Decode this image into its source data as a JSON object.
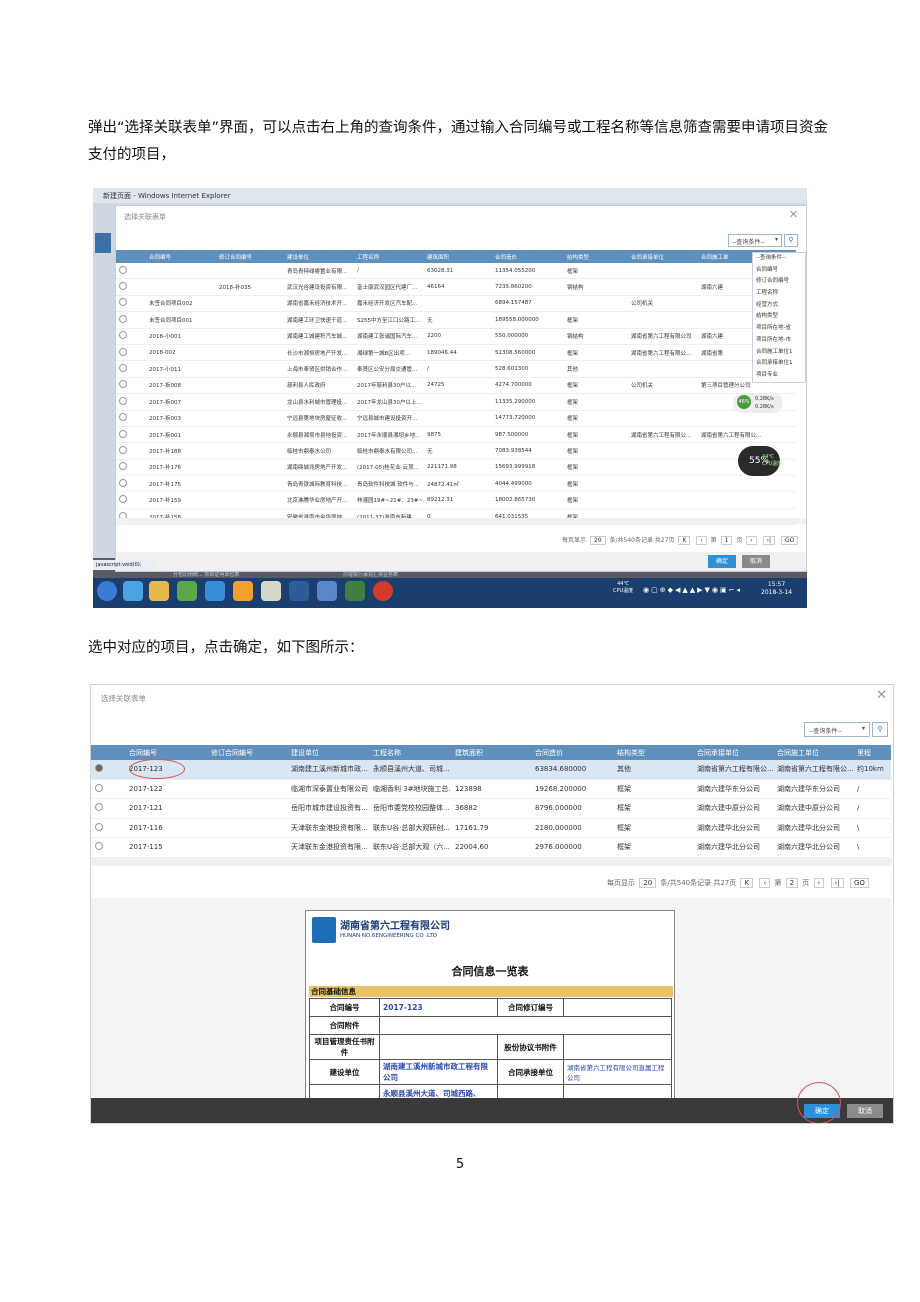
{
  "paragraph1": "弹出“选择关联表单”界面，可以点击右上角的查询条件，通过输入合同编号或工程名称等信息筛查需要申请项目资金支付的项目，",
  "paragraph2": "选中对应的项目，点击确定，如下图所示：",
  "page_number": "5",
  "shot1": {
    "window_title": "新建页面 - Windows Internet Explorer",
    "dialog_title": "选择关联表单",
    "query_select": "--查询条件--",
    "columns": [
      "",
      "合同编号",
      "修订合同编号",
      "建设单位",
      "工程名称",
      "建筑面积",
      "合同造价",
      "结构类型",
      "合同承接单位",
      "合同施工单"
    ],
    "rows": [
      [
        "",
        "",
        "青岛青特绿睿置业有限...",
        "/",
        "63028.31",
        "11354.055200",
        "框架",
        "",
        ""
      ],
      [
        "",
        "2018-补035",
        "武汉光谷建设投资有限...",
        "富士康武汉园区代建厂...",
        "46164",
        "7235.860200",
        "钢结构",
        "",
        "湖南六建"
      ],
      [
        "未签合同项目002",
        "",
        "湖南省嘉禾经济技术开...",
        "嘉禾经济开发区汽车配...",
        "",
        "6894.157487",
        "",
        "公司机关",
        ""
      ],
      [
        "未签合同项目001",
        "",
        "湖南建工环卫快速干道...",
        "S255中方至江口公路工...",
        "无",
        "189558.000000",
        "框架",
        "",
        ""
      ],
      [
        "2018-小001",
        "",
        "湖南建工城建积汽车城...",
        "湖南建工张浦国际汽车...",
        "2200",
        "550.000000",
        "钢结构",
        "湖南省第六工程有限公司",
        "湖南六建"
      ],
      [
        "2018-002",
        "",
        "长沙市湘恒房地产开发...",
        "湘绿第一城B区出项...",
        "189046.44",
        "51308.560000",
        "框架",
        "湖南省第六工程有限公...",
        "湖南省第"
      ],
      [
        "2017-小011",
        "",
        "上海市奉贤区供销合作...",
        "奉贤区公安分局交通管...",
        "/",
        "528.601300",
        "其他",
        "",
        ""
      ],
      [
        "2017-拆008",
        "",
        "慈利县人民政府",
        "2017年慈利县30户以...",
        "24725",
        "4274.700000",
        "框架",
        "公司机关",
        "第三项目管理分公司"
      ],
      [
        "2017-拆007",
        "",
        "龙山县水利城市管理投...",
        "2017年龙山县30户以上...",
        "",
        "11335.290000",
        "框架",
        "",
        ""
      ],
      [
        "2017-拆003",
        "",
        "宁远县第地块房屋征收...",
        "宁远县城市建设投资开...",
        "",
        "14773.720000",
        "框架",
        "",
        ""
      ],
      [
        "2017-拆001",
        "",
        "永顺县湘坝市县地投资...",
        "2017年永顺县湘坝乡地...",
        "9875",
        "987.500000",
        "框架",
        "湖南省第六工程有限公...",
        "湖南省第六工程有限公..."
      ],
      [
        "2017-补188",
        "",
        "临桂市鼎泰水公司",
        "临桂市鼎泰水有限公司...",
        "无",
        "7083.938544",
        "框架",
        "",
        ""
      ],
      [
        "2017-补176",
        "",
        "湖南鼎城兆房地产开发...",
        "(2017-05)桂花业·云顶...",
        "221171.98",
        "15693.999918",
        "框架",
        "",
        ""
      ],
      [
        "2017-补175",
        "",
        "青岛青铁城际教育科技...",
        "青岛软件科技城 软件与...",
        "24872.41㎡",
        "4044.499000",
        "框架",
        "",
        ""
      ],
      [
        "2017-补159",
        "",
        "北京沸腾华业房地产开...",
        "林灌园19#~21#、23#~...",
        "89212.31",
        "18002.865730",
        "框架",
        "",
        ""
      ],
      [
        "2017-补158",
        "",
        "安徽省淮南市金华房地...",
        "(2011-37)淮南市新建...",
        "0",
        "641.031535",
        "框架",
        "",
        ""
      ]
    ],
    "dropdown_options": [
      "--查询条件--",
      "合同编号",
      "修订合同编号",
      "工程名称",
      "经营方式",
      "结构类型",
      "项目所在地-省",
      "项目所在地-市",
      "合同施工单位1",
      "合同承接单位1",
      "项目专业"
    ],
    "pager": {
      "label_each": "每页显示",
      "page_size": "20",
      "total": "条/共540条记录 共27页",
      "page": "1",
      "label_page": "第",
      "label_of": "页",
      "go": "GO"
    },
    "confirm": "确定",
    "cancel": "取消",
    "status_bar": "javascript:void(0);",
    "gauge_percent": "55%",
    "gauge_temp": "44℃",
    "gauge_label": "CPU温度",
    "net_up": "0.28K/s",
    "net_down": "0.28K/s",
    "gauge_small": "46%",
    "clock_time": "15:57",
    "clock_date": "2018-3-14",
    "tray_temp": "44℃",
    "tray_label": "CPU温度",
    "behind_tab1": "分包比例统... 项目证明单位表",
    "behind_tab2": "办理银行承兑汇票业务表"
  },
  "shot2": {
    "dialog_title": "选择关联表单",
    "query_select": "--查询条件--",
    "columns": [
      "",
      "合同编号",
      "修订合同编号",
      "建设单位",
      "工程名称",
      "建筑面积",
      "合同造价",
      "结构类型",
      "合同承接单位",
      "合同施工单位",
      "里程"
    ],
    "rows": [
      [
        "2017-123",
        "",
        "湖南建工溪州新城市政...",
        "永顺县溪州大道、司城...",
        "",
        "63834.680000",
        "其他",
        "湖南省第六工程有限公...",
        "湖南省第六工程有限公...",
        "约10km"
      ],
      [
        "2017-122",
        "",
        "临湘市深泰置业有限公司",
        "临湘香利 3#地块施工总...",
        "123898",
        "19268.200000",
        "框架",
        "湖南六建华东分公司",
        "湖南六建华东分公司",
        "/"
      ],
      [
        "2017-121",
        "",
        "岳阳市城市建设投资有...",
        "岳阳市委党校校园整体...",
        "36882",
        "8796.000000",
        "框架",
        "湖南六建中原分公司",
        "湖南六建中原分公司",
        "/"
      ],
      [
        "2017-116",
        "",
        "天津联东金港投资有限...",
        "联东U谷·总部大观研创...",
        "17161.79",
        "2180.000000",
        "框架",
        "湖南六建华北分公司",
        "湖南六建华北分公司",
        "\\"
      ],
      [
        "2017-115",
        "",
        "天津联东金港投资有限...",
        "联东U谷·总部大观（六...",
        "22004.60",
        "2976.000000",
        "框架",
        "湖南六建华北分公司",
        "湖南六建华北分公司",
        "\\"
      ]
    ],
    "pager": {
      "label_each": "每页显示",
      "page_size": "20",
      "total": "条/共540条记录 共27页",
      "page": "2",
      "label_page": "第",
      "label_of": "页",
      "go": "GO"
    },
    "company_name": "湖南省第六工程有限公司",
    "company_name_en": "HUNAN NO.6ENGINEERING CO .LTD",
    "doc_title": "合同信息一览表",
    "section": "合同基础信息",
    "fields": {
      "contract_no_label": "合同编号",
      "contract_no": "2017-123",
      "revised_no_label": "合同修订编号",
      "attachment_label": "合同附件",
      "responsibility_label": "项目管理责任书附件",
      "shareholder_label": "股份协议书附件",
      "builder_label": "建设单位",
      "builder": "湖南建工溪州新城市政工程有限公司",
      "contractor_label": "合同承接单位",
      "contractor": "湖南省第六工程有限公司直属工程公司",
      "project_partial": "永顺县溪州大道、司城西路、"
    },
    "confirm": "确定",
    "cancel": "取消"
  }
}
